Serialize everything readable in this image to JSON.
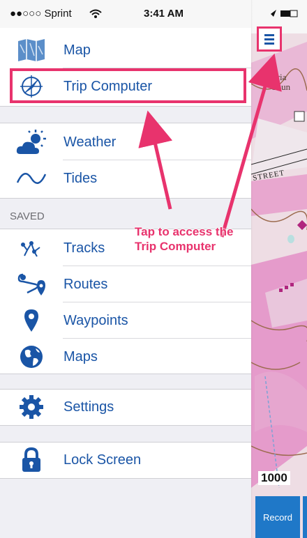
{
  "status_bar": {
    "carrier": "●●○○○ Sprint",
    "time": "3:41 AM"
  },
  "menu": {
    "group1": [
      {
        "id": "map",
        "label": "Map",
        "icon": "map-icon"
      },
      {
        "id": "trip-computer",
        "label": "Trip Computer",
        "icon": "compass-icon"
      }
    ],
    "group2": [
      {
        "id": "weather",
        "label": "Weather",
        "icon": "weather-icon"
      },
      {
        "id": "tides",
        "label": "Tides",
        "icon": "tides-icon"
      }
    ],
    "saved_header": "SAVED",
    "saved": [
      {
        "id": "tracks",
        "label": "Tracks",
        "icon": "tracks-icon"
      },
      {
        "id": "routes",
        "label": "Routes",
        "icon": "routes-icon"
      },
      {
        "id": "waypoints",
        "label": "Waypoints",
        "icon": "waypoint-pin-icon"
      },
      {
        "id": "maps",
        "label": "Maps",
        "icon": "globe-icon"
      }
    ],
    "settings": {
      "label": "Settings",
      "icon": "gear-icon"
    },
    "lock": {
      "label": "Lock Screen",
      "icon": "lock-icon"
    }
  },
  "annotation": {
    "text": "Tap to access the Trip Computer",
    "color": "#e8336d"
  },
  "map_panel": {
    "street_label": "STREET",
    "place_label": "Bria Coun",
    "scale": "1000",
    "record_button": "Record"
  },
  "colors": {
    "label": "#1a55a6",
    "accent": "#e8336d",
    "record": "#1f78c8"
  }
}
